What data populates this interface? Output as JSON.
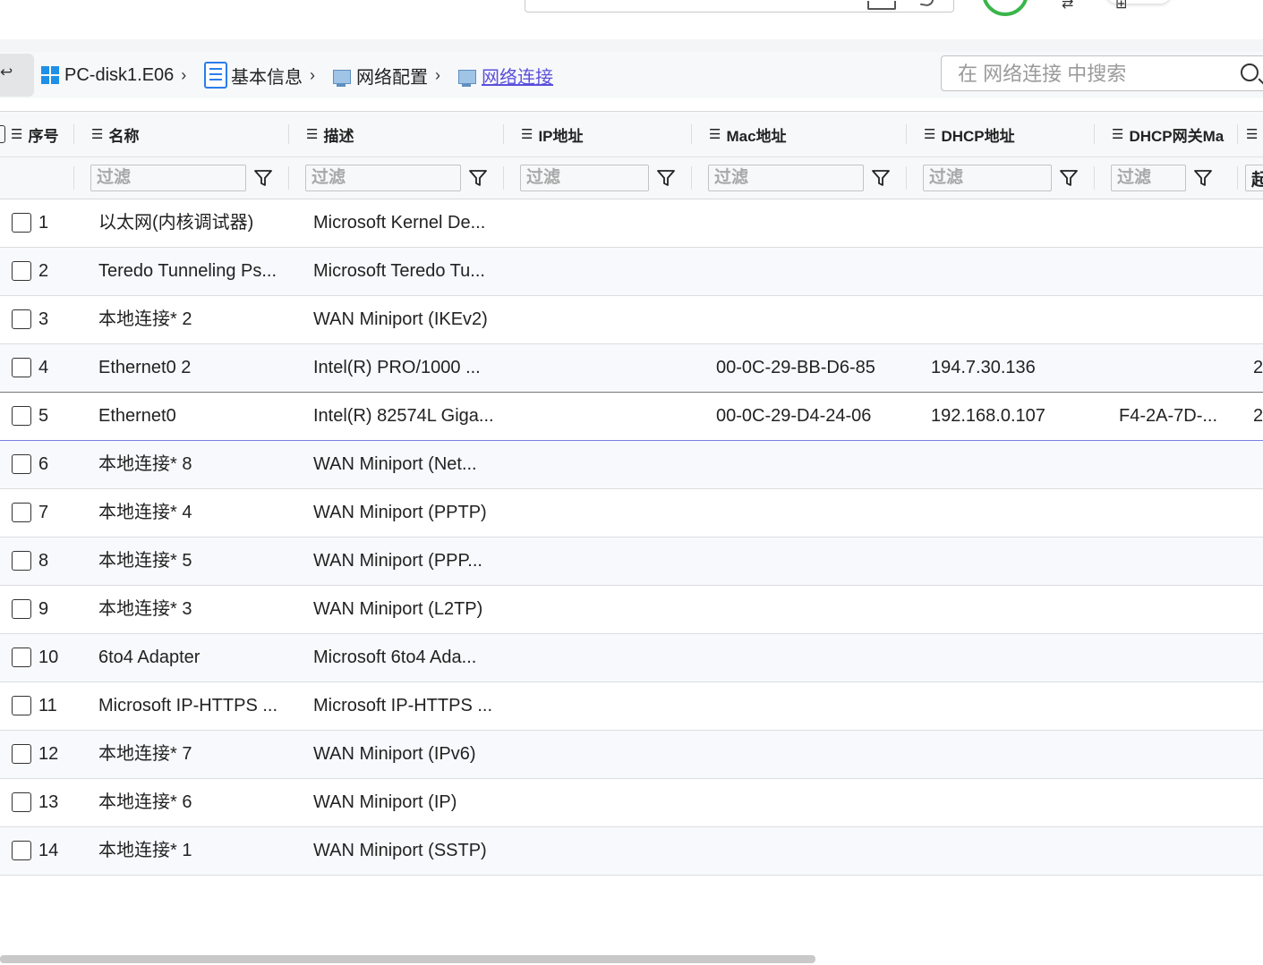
{
  "top": {
    "search_icon": "magnifier-icon",
    "status_icon": "status-ring-icon"
  },
  "breadcrumb": {
    "back_icon": "back-icon",
    "items": [
      {
        "label": "PC-disk1.E06",
        "icon": "windows-logo-icon"
      },
      {
        "label": "基本信息",
        "icon": "list-icon"
      },
      {
        "label": "网络配置",
        "icon": "network-adapter-icon"
      },
      {
        "label": "网络连接",
        "icon": "network-adapter-icon"
      }
    ],
    "separator": "›"
  },
  "search": {
    "placeholder": "在 网络连接 中搜索"
  },
  "table": {
    "columns": [
      "序号",
      "名称",
      "描述",
      "IP地址",
      "Mac地址",
      "DHCP地址",
      "DHCP网关Ma",
      ""
    ],
    "filter_placeholder": "过滤",
    "partial_filter_text": "起",
    "rows": [
      {
        "n": "1",
        "name": "以太网(内核调试器)",
        "desc": "Microsoft Kernel De...",
        "ip": "",
        "mac": "",
        "dhcp": "",
        "gw": "",
        "x": ""
      },
      {
        "n": "2",
        "name": "Teredo Tunneling Ps...",
        "desc": "Microsoft Teredo Tu...",
        "ip": "",
        "mac": "",
        "dhcp": "",
        "gw": "",
        "x": ""
      },
      {
        "n": "3",
        "name": "本地连接* 2",
        "desc": "WAN Miniport (IKEv2)",
        "ip": "",
        "mac": "",
        "dhcp": "",
        "gw": "",
        "x": ""
      },
      {
        "n": "4",
        "name": "Ethernet0 2",
        "desc": "Intel(R) PRO/1000 ...",
        "ip": "",
        "mac": "00-0C-29-BB-D6-85",
        "dhcp": "194.7.30.136",
        "gw": "",
        "x": "2"
      },
      {
        "n": "5",
        "name": "Ethernet0",
        "desc": "Intel(R) 82574L Giga...",
        "ip": "",
        "mac": "00-0C-29-D4-24-06",
        "dhcp": "192.168.0.107",
        "gw": "F4-2A-7D-...",
        "x": "2"
      },
      {
        "n": "6",
        "name": "本地连接* 8",
        "desc": "WAN Miniport (Net...",
        "ip": "",
        "mac": "",
        "dhcp": "",
        "gw": "",
        "x": ""
      },
      {
        "n": "7",
        "name": "本地连接* 4",
        "desc": "WAN Miniport (PPTP)",
        "ip": "",
        "mac": "",
        "dhcp": "",
        "gw": "",
        "x": ""
      },
      {
        "n": "8",
        "name": "本地连接* 5",
        "desc": "WAN Miniport (PPP...",
        "ip": "",
        "mac": "",
        "dhcp": "",
        "gw": "",
        "x": ""
      },
      {
        "n": "9",
        "name": "本地连接* 3",
        "desc": "WAN Miniport (L2TP)",
        "ip": "",
        "mac": "",
        "dhcp": "",
        "gw": "",
        "x": ""
      },
      {
        "n": "10",
        "name": "6to4 Adapter",
        "desc": "Microsoft 6to4 Ada...",
        "ip": "",
        "mac": "",
        "dhcp": "",
        "gw": "",
        "x": ""
      },
      {
        "n": "11",
        "name": "Microsoft IP-HTTPS ...",
        "desc": "Microsoft IP-HTTPS ...",
        "ip": "",
        "mac": "",
        "dhcp": "",
        "gw": "",
        "x": ""
      },
      {
        "n": "12",
        "name": "本地连接* 7",
        "desc": "WAN Miniport (IPv6)",
        "ip": "",
        "mac": "",
        "dhcp": "",
        "gw": "",
        "x": ""
      },
      {
        "n": "13",
        "name": "本地连接* 6",
        "desc": "WAN Miniport (IP)",
        "ip": "",
        "mac": "",
        "dhcp": "",
        "gw": "",
        "x": ""
      },
      {
        "n": "14",
        "name": "本地连接* 1",
        "desc": "WAN Miniport (SSTP)",
        "ip": "",
        "mac": "",
        "dhcp": "",
        "gw": "",
        "x": ""
      }
    ]
  },
  "colors": {
    "accent": "#5b4fdb",
    "status_ring": "#3bb54a",
    "windows_blue": "#1e90e8"
  }
}
